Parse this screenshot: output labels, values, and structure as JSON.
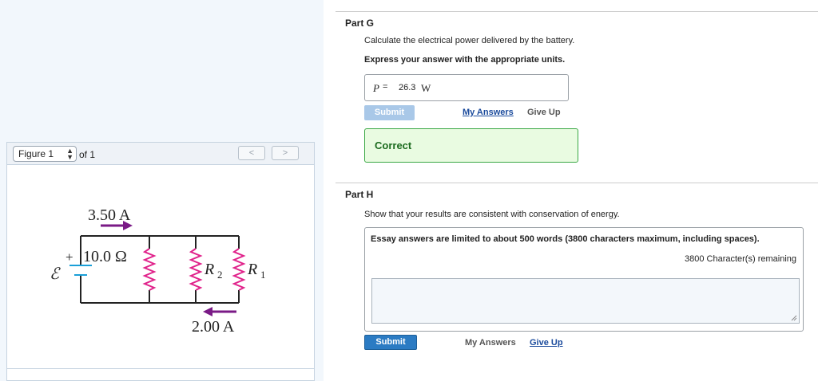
{
  "figure": {
    "select_value": "Figure 1",
    "of_label": "of 1",
    "prev": "<",
    "next": ">",
    "circuit": {
      "current_total": "3.50 A",
      "resistance": "10.0 Ω",
      "emf_symbol": "ℰ",
      "plus": "+",
      "r2": "R",
      "r2_sub": "2",
      "r1": "R",
      "r1_sub": "1",
      "current_branch": "2.00 A"
    }
  },
  "partG": {
    "title": "Part G",
    "prompt": "Calculate the electrical power delivered by the battery.",
    "instruction": "Express your answer with the appropriate units.",
    "answer_label": "P",
    "answer_eq": "=",
    "answer_value": "26.3",
    "answer_unit": "W",
    "submit": "Submit",
    "my_answers": "My Answers",
    "give_up": "Give Up",
    "status": "Correct"
  },
  "partH": {
    "title": "Part H",
    "prompt": "Show that your results are consistent with conservation of energy.",
    "essay_note": "Essay answers are limited to about 500 words (3800 characters maximum, including spaces).",
    "remaining": "3800 Character(s) remaining",
    "submit": "Submit",
    "my_answers": "My Answers",
    "give_up": "Give Up"
  },
  "colors": {
    "accent": "#2b7bc3",
    "correct_bg": "#e9fbe1",
    "correct_border": "#3aa845",
    "resistor": "#e0218a",
    "arrow": "#7a1a86",
    "battery": "#1a9fd8"
  }
}
